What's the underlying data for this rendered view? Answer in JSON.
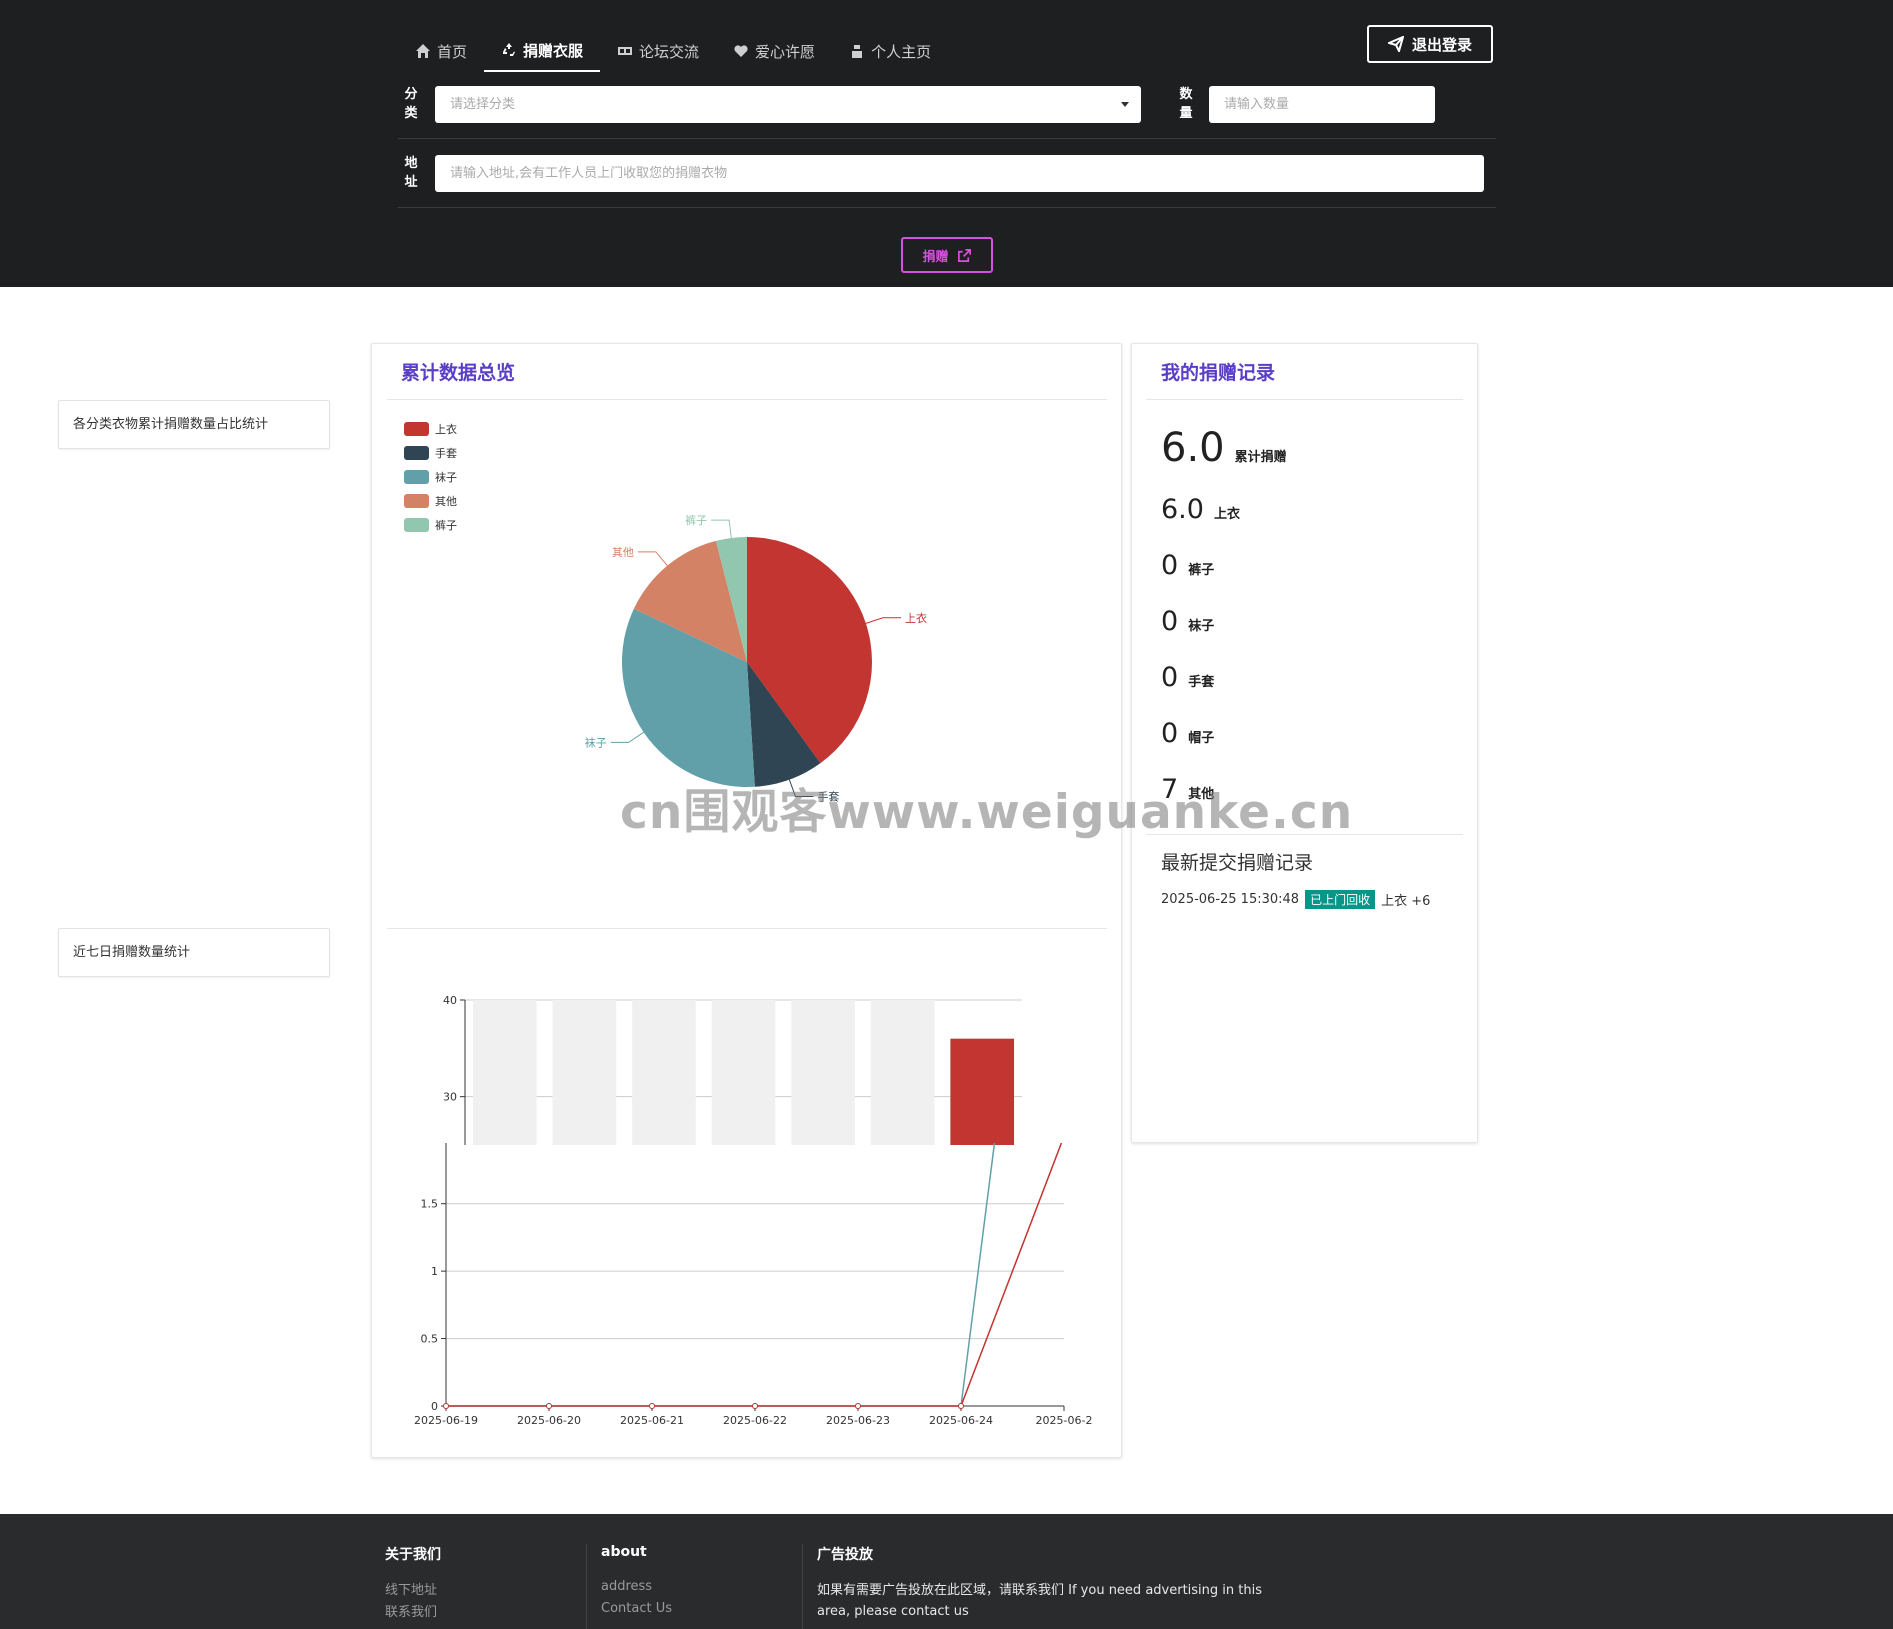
{
  "nav": {
    "items": [
      {
        "label": "首页",
        "icon": "home-icon",
        "active": false
      },
      {
        "label": "捐赠衣服",
        "icon": "recycle-icon",
        "active": true
      },
      {
        "label": "论坛交流",
        "icon": "forum-icon",
        "active": false
      },
      {
        "label": "爱心许愿",
        "icon": "heart-icon",
        "active": false
      },
      {
        "label": "个人主页",
        "icon": "user-icon",
        "active": false
      }
    ],
    "logout_label": "退出登录"
  },
  "form": {
    "category_label": "分类",
    "category_placeholder": "请选择分类",
    "quantity_label": "数量",
    "quantity_placeholder": "请输入数量",
    "address_label": "地址",
    "address_placeholder": "请输入地址,会有工作人员上门收取您的捐赠衣物",
    "donate_label": "捐赠"
  },
  "side": {
    "pie_caption": "各分类衣物累计捐赠数量占比统计",
    "week_caption": "近七日捐赠数量统计"
  },
  "overview": {
    "title": "累计数据总览"
  },
  "records": {
    "title": "我的捐赠记录",
    "total_value": "6.0",
    "total_label": "累计捐赠",
    "items": [
      {
        "value": "6.0",
        "label": "上衣"
      },
      {
        "value": "0",
        "label": "裤子"
      },
      {
        "value": "0",
        "label": "袜子"
      },
      {
        "value": "0",
        "label": "手套"
      },
      {
        "value": "0",
        "label": "帽子"
      },
      {
        "value": "7",
        "label": "其他"
      }
    ],
    "latest_title": "最新提交捐赠记录",
    "latest": {
      "time": "2025-06-25 15:30:48",
      "status": "已上门回收",
      "detail": "上衣 +6"
    }
  },
  "watermark": "cn围观客www.weiguanke.cn",
  "footer": {
    "about_cn_title": "关于我们",
    "about_cn_links": [
      "线下地址",
      "联系我们"
    ],
    "about_en_title": "about",
    "about_en_links": [
      "address",
      "Contact Us"
    ],
    "ad_title": "广告投放",
    "ad_text": "如果有需要广告投放在此区域，请联系我们 If you need advertising in this area, please contact us"
  },
  "colors": {
    "header_bg": "#1e1f21",
    "accent_purple": "#5a3ec8",
    "donate_pink": "#d94fe0",
    "status_green": "#079688",
    "red": "#c23531",
    "dark": "#2f4554",
    "teal": "#61a0a8",
    "orange": "#d48265",
    "mint": "#91c7ae"
  },
  "chart_data": [
    {
      "type": "pie",
      "legend": [
        "上衣",
        "手套",
        "袜子",
        "其他",
        "裤子"
      ],
      "legend_position": "top-left",
      "slices": [
        {
          "label": "上衣",
          "value": 40,
          "color": "#c23531"
        },
        {
          "label": "手套",
          "value": 9,
          "color": "#2f4554"
        },
        {
          "label": "袜子",
          "value": 33,
          "color": "#61a0a8"
        },
        {
          "label": "其他",
          "value": 14,
          "color": "#d48265"
        },
        {
          "label": "裤子",
          "value": 4,
          "color": "#91c7ae"
        }
      ]
    },
    {
      "type": "bar",
      "visible_ticks": [
        "40",
        "30"
      ],
      "ylim_visible": [
        25,
        40
      ],
      "bars": [
        {
          "value": 40,
          "color": "#f0f0f0"
        },
        {
          "value": 40,
          "color": "#f0f0f0"
        },
        {
          "value": 40,
          "color": "#f0f0f0"
        },
        {
          "value": 40,
          "color": "#f0f0f0"
        },
        {
          "value": 40,
          "color": "#f0f0f0"
        },
        {
          "value": 40,
          "color": "#f0f0f0"
        },
        {
          "value": 36,
          "color": "#c23531"
        }
      ]
    },
    {
      "type": "line",
      "x": [
        "2025-06-19",
        "2025-06-20",
        "2025-06-21",
        "2025-06-22",
        "2025-06-23",
        "2025-06-24",
        "2025-06-2"
      ],
      "y_ticks": [
        "0",
        "0.5",
        "1",
        "1.5"
      ],
      "ylim": [
        0,
        1.95
      ],
      "grid": true,
      "series": [
        {
          "values": [
            0,
            0,
            0,
            0,
            0,
            0,
            6
          ],
          "color": "#61a0a8"
        },
        {
          "values": [
            0,
            0,
            0,
            0,
            0,
            0,
            2
          ],
          "color": "#c23531"
        }
      ]
    }
  ]
}
